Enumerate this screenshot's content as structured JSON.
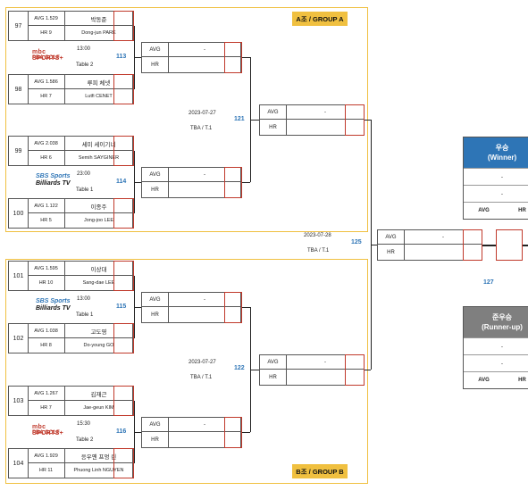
{
  "groups": {
    "a": {
      "label": "A조 / GROUP A"
    },
    "b": {
      "label": "B조 / GROUP B"
    }
  },
  "players": [
    {
      "seed": "97",
      "avg": "AVG 1.529",
      "hr": "HR 9",
      "name_ko": "박동준",
      "name_en": "Dong-jun PARK"
    },
    {
      "seed": "98",
      "avg": "AVG 1.586",
      "hr": "HR 7",
      "name_ko": "루피 체넷",
      "name_en": "Lutfi CENET"
    },
    {
      "seed": "99",
      "avg": "AVG 2.038",
      "hr": "HR 6",
      "name_ko": "세미 세이기너",
      "name_en": "Semih SAYGINER"
    },
    {
      "seed": "100",
      "avg": "AVG 1.122",
      "hr": "HR 5",
      "name_ko": "이종주",
      "name_en": "Jong-joo LEE"
    },
    {
      "seed": "101",
      "avg": "AVG 1.595",
      "hr": "HR 10",
      "name_ko": "이상대",
      "name_en": "Sang-dae LEE"
    },
    {
      "seed": "102",
      "avg": "AVG 1.038",
      "hr": "HR 8",
      "name_ko": "고도영",
      "name_en": "Do-young GO"
    },
    {
      "seed": "103",
      "avg": "AVG 1.267",
      "hr": "HR 7",
      "name_ko": "김재근",
      "name_en": "Jae-geun KIM"
    },
    {
      "seed": "104",
      "avg": "AVG 1.929",
      "hr": "HR 11",
      "name_ko": "응우옌 프엉 린",
      "name_en": "Phuong Linh NGUYEN"
    }
  ],
  "matches": {
    "m113": {
      "no": "113",
      "time": "13:00",
      "table": "Table 2",
      "broadcaster": "MBC SPORTS+ / PBA GOLF",
      "avg_label": "AVG",
      "hr_label": "HR",
      "avg_val": "-"
    },
    "m114": {
      "no": "114",
      "time": "23:00",
      "table": "Table 1",
      "broadcaster": "SBS Sports / Billiards TV",
      "avg_label": "AVG",
      "hr_label": "HR",
      "avg_val": "-"
    },
    "m115": {
      "no": "115",
      "time": "13:00",
      "table": "Table 1",
      "broadcaster": "SBS Sports / Billiards TV",
      "avg_label": "AVG",
      "hr_label": "HR",
      "avg_val": "-"
    },
    "m116": {
      "no": "116",
      "time": "15:30",
      "table": "Table 2",
      "broadcaster": "MBC SPORTS+ / PBA GOLF",
      "avg_label": "AVG",
      "hr_label": "HR",
      "avg_val": "-"
    },
    "m121": {
      "no": "121",
      "date": "2023-07-27",
      "table": "TBA / T.1",
      "avg_label": "AVG",
      "hr_label": "HR",
      "avg_val": "-"
    },
    "m122": {
      "no": "122",
      "date": "2023-07-27",
      "table": "TBA / T.1",
      "avg_label": "AVG",
      "hr_label": "HR",
      "avg_val": "-"
    },
    "m125": {
      "no": "125",
      "date": "2023-07-28",
      "table": "TBA / T.1",
      "avg_label": "AVG",
      "hr_label": "HR",
      "avg_val": "-"
    },
    "m127": {
      "no": "127"
    }
  },
  "logos": {
    "mbc_line1": "mbc SPORTS+",
    "mbc_line2": "PBA GOLF",
    "sbs_line1": "SBS Sports",
    "sbs_line2": "Billiards TV"
  },
  "winner": {
    "title_ko": "우승",
    "title_en": "(Winner)",
    "row1": "-",
    "row2": "-",
    "avg_label": "AVG",
    "hr_label": "HR",
    "color": "#2e75b6"
  },
  "runner_up": {
    "title_ko": "준우승",
    "title_en": "(Runner-up)",
    "row1": "-",
    "row2": "-",
    "avg_label": "AVG",
    "hr_label": "HR",
    "color": "#7f7f7f"
  },
  "colors": {
    "group_border": "#f0c040",
    "match_number": "#2e75b6",
    "accent_red": "#c0392b"
  }
}
